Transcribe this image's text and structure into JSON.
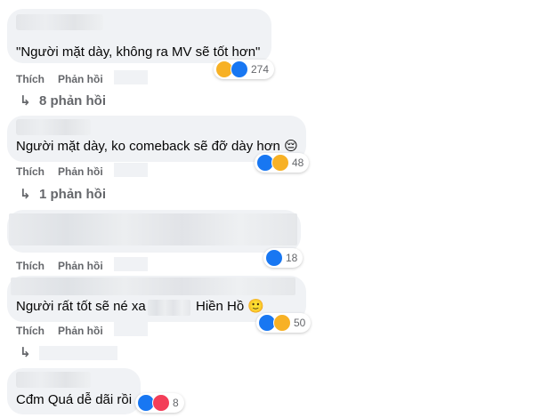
{
  "comments": [
    {
      "text": "\"Người mặt dày, không ra MV sẽ tốt hơn\"",
      "like": "Thích",
      "reply": "Phản hồi",
      "reaction_count": "274",
      "replies_label": "8 phản hồi"
    },
    {
      "text": "Người mặt dày, ko comeback sẽ đỡ dày hơn 😔",
      "like": "Thích",
      "reply": "Phản hồi",
      "reaction_count": "48",
      "replies_label": "1 phản hồi"
    },
    {
      "text": "",
      "like": "Thích",
      "reply": "Phản hồi",
      "reaction_count": "18"
    },
    {
      "text_before": "Người rất tốt sẽ né xa",
      "text_after": "Hiền Hồ 🙂",
      "like": "Thích",
      "reply": "Phản hồi",
      "reaction_count": "50"
    },
    {
      "text": "Cđm Quá dễ dãi rồi",
      "reaction_count": "8"
    }
  ],
  "icons": {
    "reply_arrow": "reply-arrow-icon",
    "like": "like-reaction-icon",
    "haha": "haha-reaction-icon",
    "love": "love-reaction-icon"
  },
  "colors": {
    "bubble": "#f0f2f5",
    "like_blue": "#1877f2",
    "haha_yellow": "#f7b125",
    "love_red": "#f33e58",
    "meta_gray": "#65676b"
  }
}
